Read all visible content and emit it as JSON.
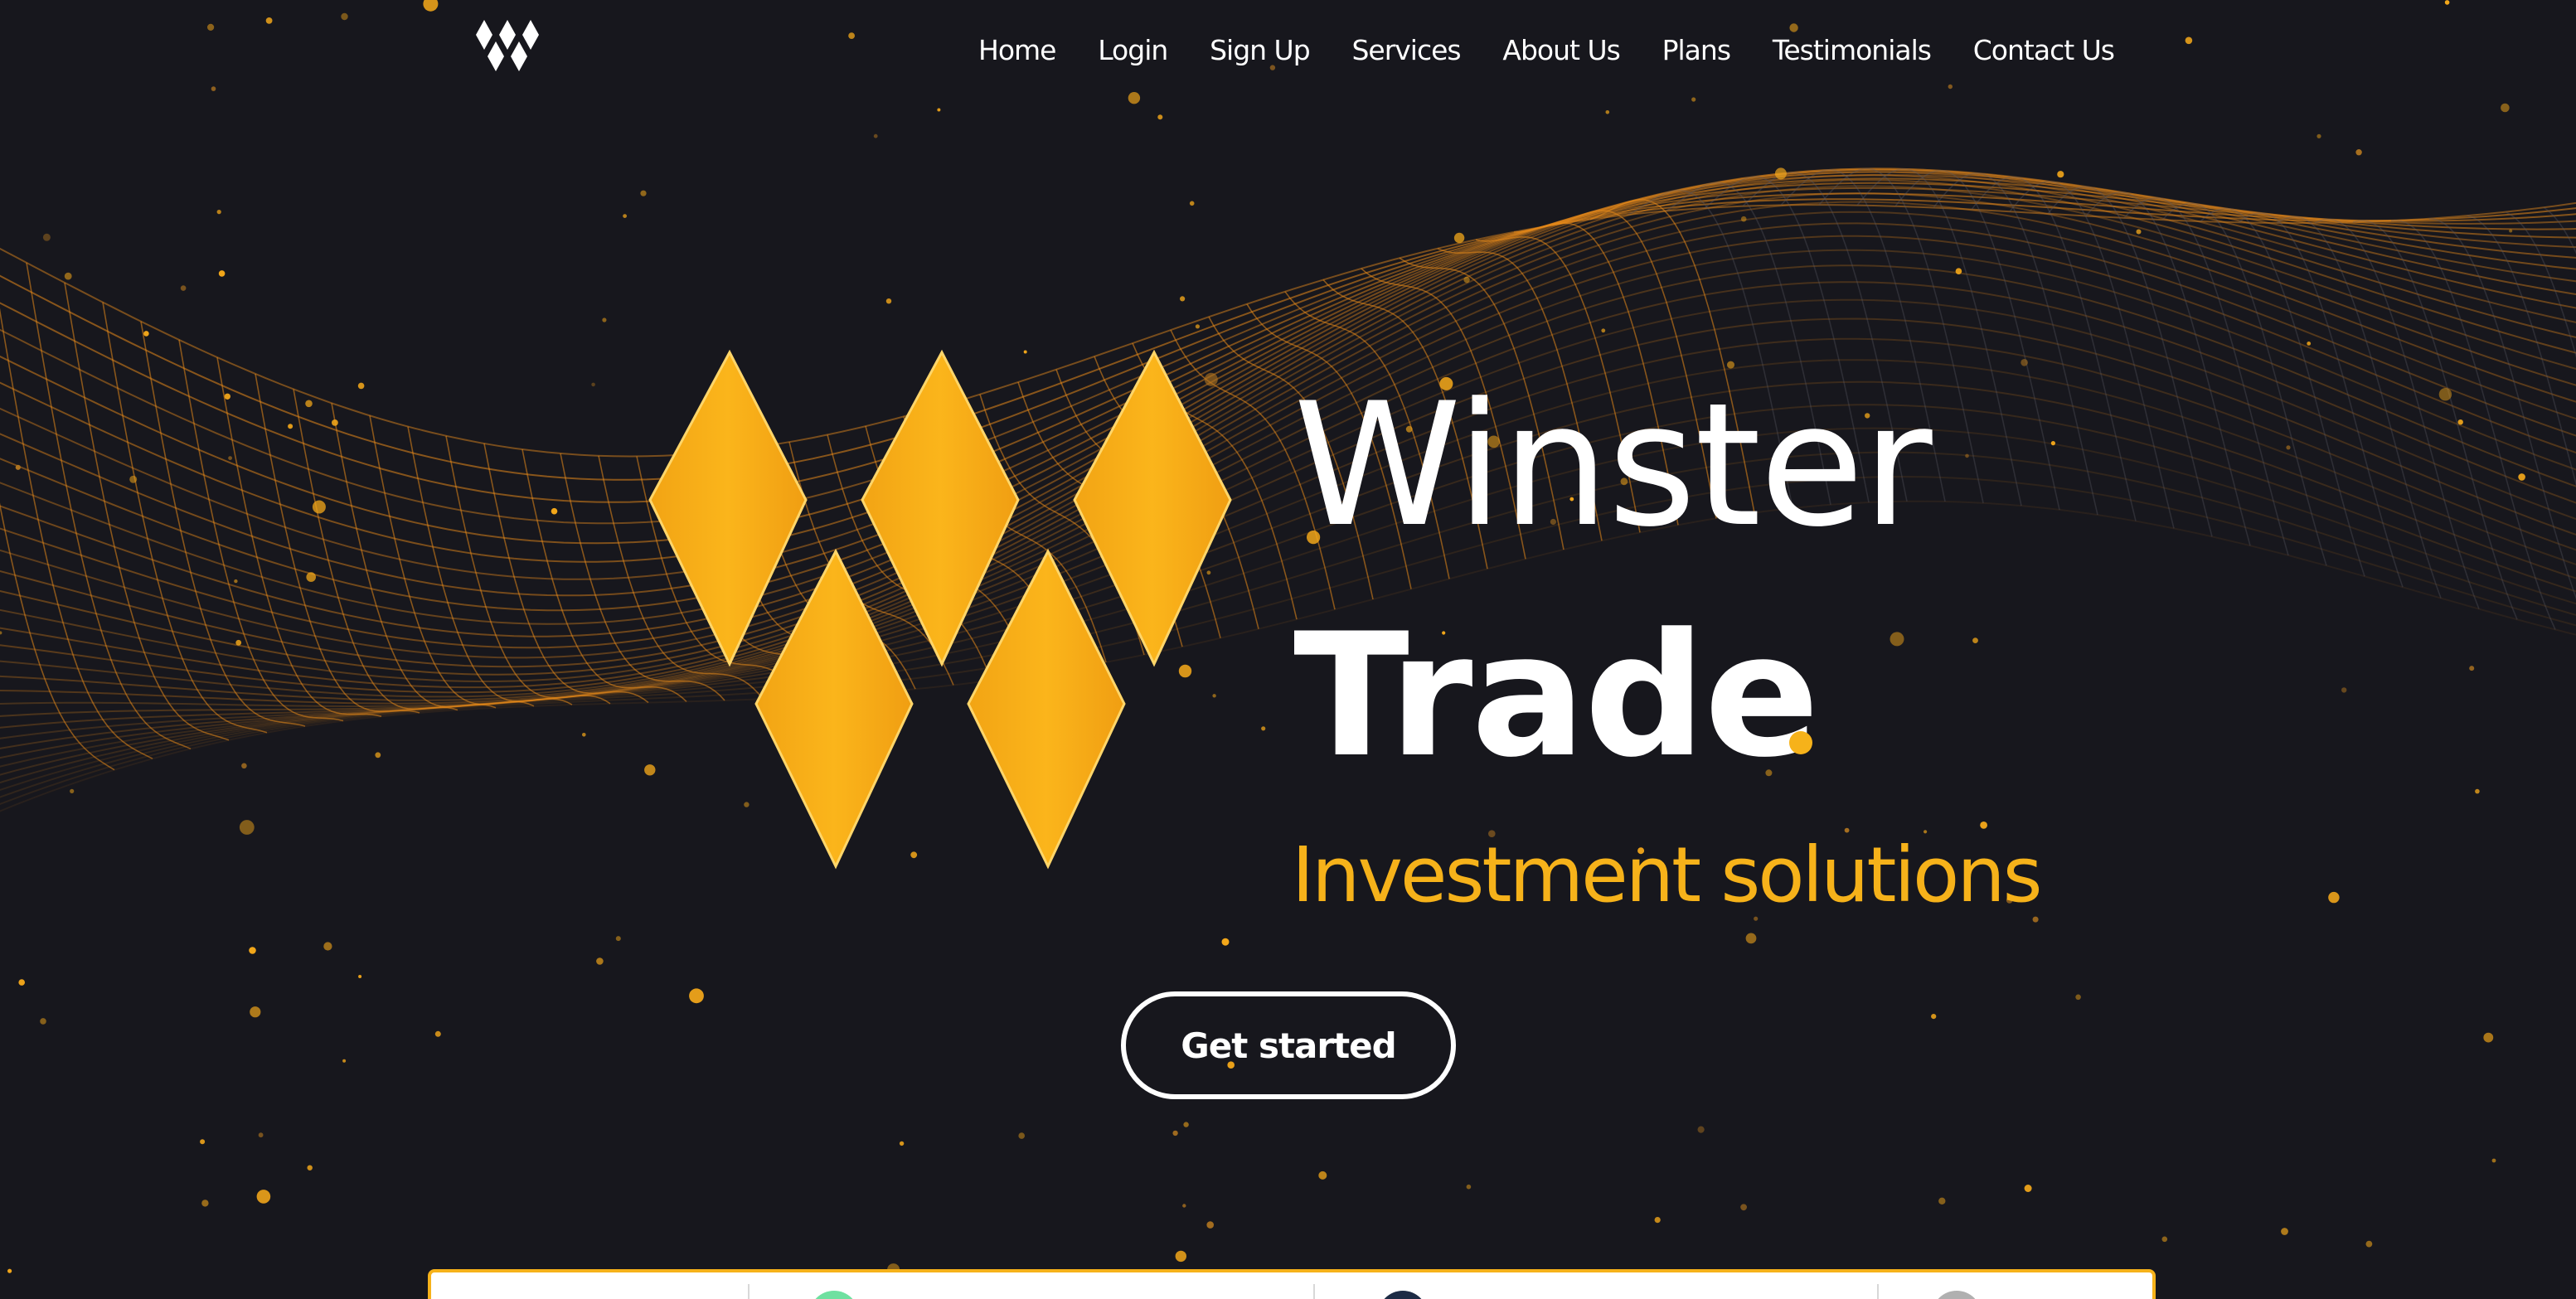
{
  "brand": {
    "name_line1": "Winster",
    "name_line2": "Trade",
    "tagline": "Investment solutions",
    "logo_icon": "diamond-w-logo-icon"
  },
  "nav": {
    "items": [
      {
        "label": "Home"
      },
      {
        "label": "Login"
      },
      {
        "label": "Sign Up"
      },
      {
        "label": "Services"
      },
      {
        "label": "About Us"
      },
      {
        "label": "Plans"
      },
      {
        "label": "Testimonials"
      },
      {
        "label": "Contact Us"
      }
    ]
  },
  "hero": {
    "cta_label": "Get started",
    "background": "orange-wireframe-wave"
  },
  "features_card": {
    "icons": [
      "green-feature-icon",
      "navy-feature-icon",
      "gray-feature-icon"
    ]
  },
  "colors": {
    "background": "#17171d",
    "accent": "#f6b21a",
    "text": "#ffffff",
    "wave": "#e88a1a"
  }
}
